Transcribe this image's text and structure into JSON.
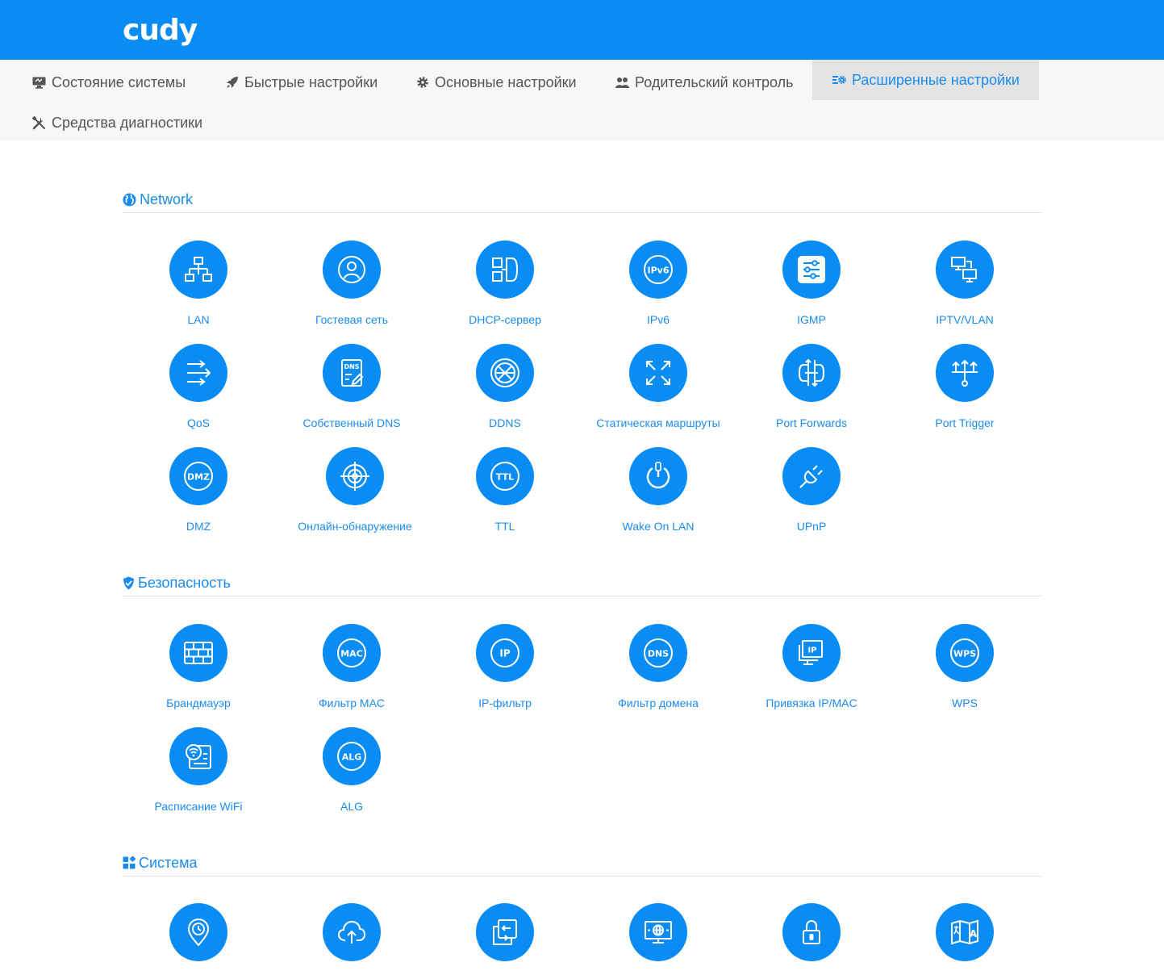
{
  "header": {
    "logo": "cudy",
    "background": "#0a8cf5"
  },
  "nav": {
    "items": [
      {
        "label": "Состояние системы",
        "icon": "monitor-icon"
      },
      {
        "label": "Быстрые настройки",
        "icon": "rocket-icon"
      },
      {
        "label": "Основные настройки",
        "icon": "gear-icon"
      },
      {
        "label": "Родительский контроль",
        "icon": "users-icon"
      },
      {
        "label": "Расширенные настройки",
        "icon": "advanced-settings-icon",
        "active": true
      },
      {
        "label": "Средства диагностики",
        "icon": "tools-icon"
      }
    ]
  },
  "sections": [
    {
      "title": "Network",
      "icon": "globe-icon",
      "tiles": [
        {
          "label": "LAN",
          "icon": "lan-icon"
        },
        {
          "label": "Гостевая сеть",
          "icon": "guest-user-icon"
        },
        {
          "label": "DHCP-сервер",
          "icon": "dhcp-icon"
        },
        {
          "label": "IPv6",
          "icon": "ipv6-icon"
        },
        {
          "label": "IGMP",
          "icon": "igmp-icon"
        },
        {
          "label": "IPTV/VLAN",
          "icon": "iptv-icon"
        },
        {
          "label": "QoS",
          "icon": "qos-icon"
        },
        {
          "label": "Собственный DNS",
          "icon": "custom-dns-icon"
        },
        {
          "label": "DDNS",
          "icon": "ddns-icon"
        },
        {
          "label": "Статическая маршруты",
          "icon": "static-route-icon"
        },
        {
          "label": "Port Forwards",
          "icon": "port-forward-icon"
        },
        {
          "label": "Port Trigger",
          "icon": "port-trigger-icon"
        },
        {
          "label": "DMZ",
          "icon": "dmz-icon"
        },
        {
          "label": "Онлайн-обнаружение",
          "icon": "online-detection-icon"
        },
        {
          "label": "TTL",
          "icon": "ttl-icon"
        },
        {
          "label": "Wake On LAN",
          "icon": "wake-on-lan-icon"
        },
        {
          "label": "UPnP",
          "icon": "upnp-icon"
        }
      ]
    },
    {
      "title": "Безопасность",
      "icon": "shield-icon",
      "tiles": [
        {
          "label": "Брандмауэр",
          "icon": "firewall-icon"
        },
        {
          "label": "Фильтр MAC",
          "icon": "mac-filter-icon"
        },
        {
          "label": "IP-фильтр",
          "icon": "ip-filter-icon"
        },
        {
          "label": "Фильтр домена",
          "icon": "domain-filter-icon"
        },
        {
          "label": "Привязка IP/MAC",
          "icon": "ip-mac-binding-icon"
        },
        {
          "label": "WPS",
          "icon": "wps-icon"
        },
        {
          "label": "Расписание WiFi",
          "icon": "wifi-schedule-icon"
        },
        {
          "label": "ALG",
          "icon": "alg-icon"
        }
      ]
    },
    {
      "title": "Система",
      "icon": "apps-icon",
      "tiles": [
        {
          "label": "",
          "icon": "time-location-icon"
        },
        {
          "label": "",
          "icon": "cloud-upload-icon"
        },
        {
          "label": "",
          "icon": "backup-restore-icon"
        },
        {
          "label": "",
          "icon": "remote-management-icon"
        },
        {
          "label": "",
          "icon": "password-lock-icon"
        },
        {
          "label": "",
          "icon": "language-icon"
        }
      ]
    }
  ],
  "text_badges": {
    "ipv6": "IPv6",
    "dns": "DNS",
    "dmz": "DMZ",
    "ttl": "TTL",
    "mac": "MAC",
    "ip": "IP",
    "wps": "WPS",
    "alg": "ALG",
    "lang": "A"
  },
  "colors": {
    "accent": "#1a8cf0",
    "circle": "#0a8cf5",
    "nav_bg": "#f7f7f7",
    "nav_active_bg": "#e3e3e3"
  }
}
